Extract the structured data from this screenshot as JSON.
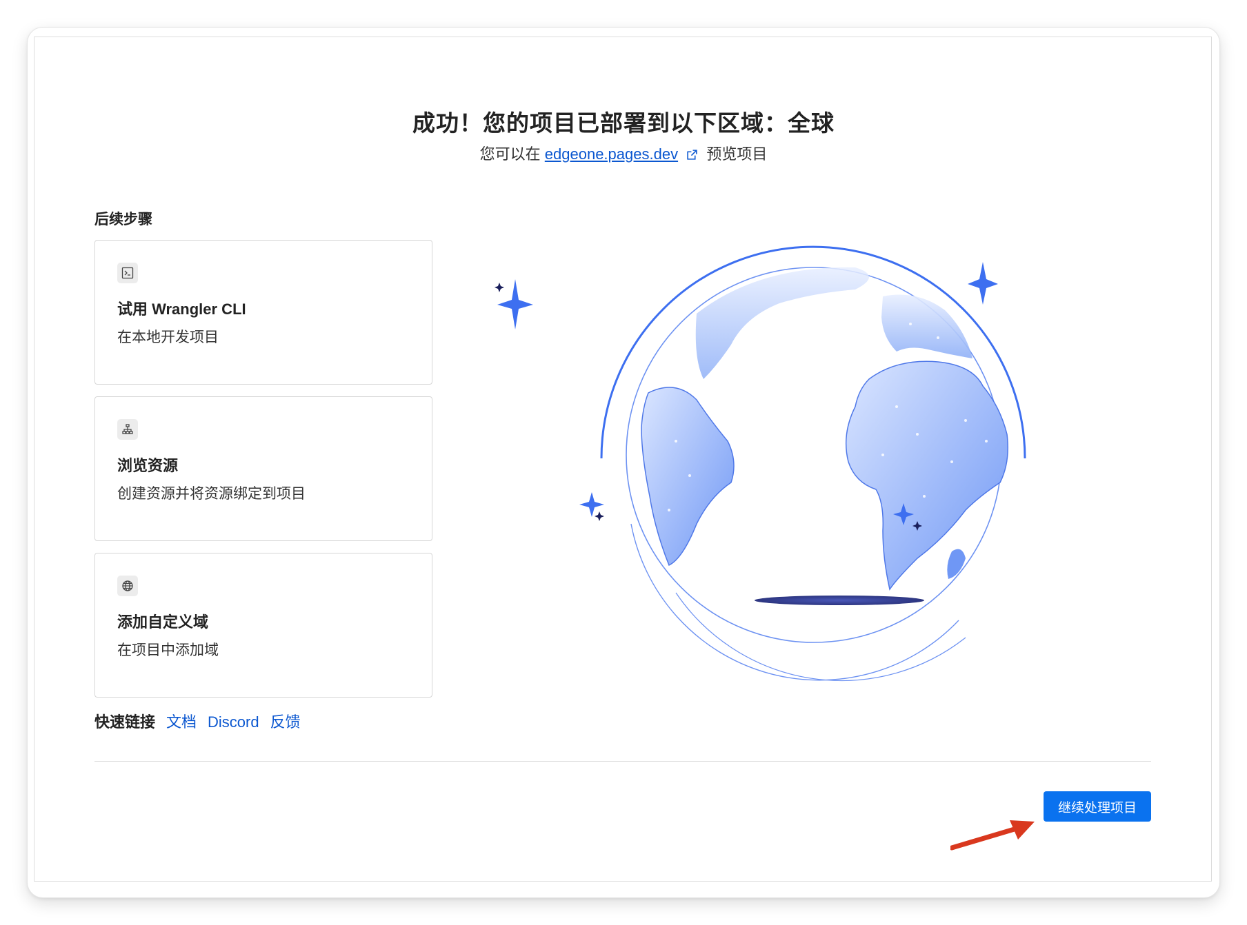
{
  "header": {
    "title": "成功！您的项目已部署到以下区域：全球",
    "subtitle_prefix": "您可以在",
    "subtitle_link": "edgeone.pages.dev",
    "subtitle_suffix": "预览项目"
  },
  "next_steps": {
    "label": "后续步骤",
    "cards": [
      {
        "icon": "terminal-icon",
        "title": "试用 Wrangler CLI",
        "desc": "在本地开发项目"
      },
      {
        "icon": "sitemap-icon",
        "title": "浏览资源",
        "desc": "创建资源并将资源绑定到项目"
      },
      {
        "icon": "globe-icon",
        "title": "添加自定义域",
        "desc": "在项目中添加域"
      }
    ]
  },
  "quick_links": {
    "label": "快速链接",
    "items": [
      "文档",
      "Discord",
      "反馈"
    ]
  },
  "footer": {
    "continue_label": "继续处理项目"
  },
  "colors": {
    "accent": "#0a72ef",
    "link": "#0b57d0",
    "globe_blue": "#3d6ff0",
    "annotation_arrow": "#d9381e"
  }
}
